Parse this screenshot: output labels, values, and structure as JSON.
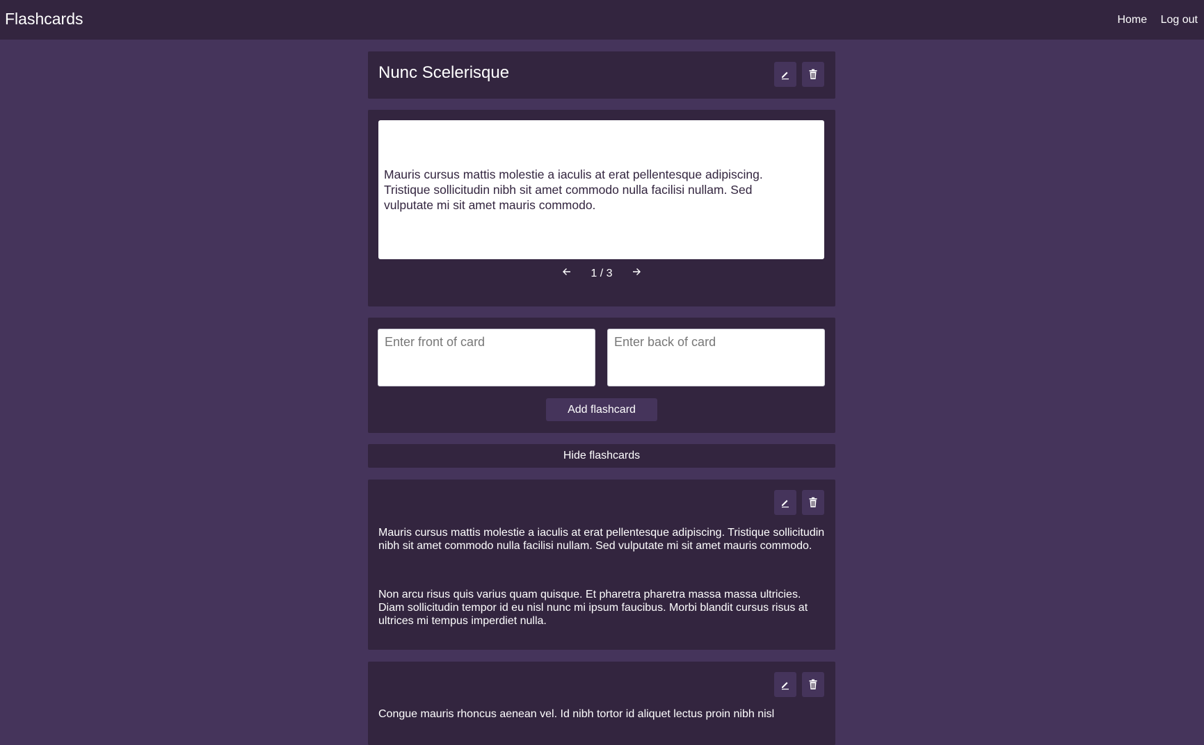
{
  "app": {
    "brand": "Flashcards",
    "nav": {
      "home": "Home",
      "logout": "Log out"
    }
  },
  "deck": {
    "title": "Nunc Scelerisque",
    "edit_icon": "pencil-icon",
    "delete_icon": "trash-icon"
  },
  "study": {
    "card_text": "Mauris cursus mattis molestie a iaculis at erat pellentesque adipiscing. Tristique sollicitudin nibh sit amet commodo nulla facilisi nullam. Sed vulputate mi sit amet mauris commodo.",
    "prev_icon": "arrow-left-icon",
    "next_icon": "arrow-right-icon",
    "position": "1 / 3"
  },
  "new_card": {
    "front_placeholder": "Enter front of card",
    "back_placeholder": "Enter back of card",
    "front_value": "",
    "back_value": "",
    "add_label": "Add flashcard"
  },
  "list": {
    "toggle_label": "Hide flashcards",
    "cards": [
      {
        "front": "Mauris cursus mattis molestie a iaculis at erat pellentesque adipiscing. Tristique sollicitudin nibh sit amet commodo nulla facilisi nullam. Sed vulputate mi sit amet mauris commodo.",
        "back": "Non arcu risus quis varius quam quisque. Et pharetra pharetra massa massa ultricies. Diam sollicitudin tempor id eu nisl nunc mi ipsum faucibus. Morbi blandit cursus risus at ultrices mi tempus imperdiet nulla."
      },
      {
        "front": "Congue mauris rhoncus aenean vel. Id nibh tortor id aliquet lectus proin nibh nisl"
      }
    ]
  }
}
